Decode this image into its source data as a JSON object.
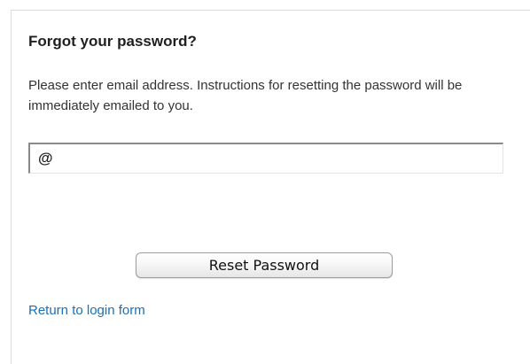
{
  "form": {
    "title": "Forgot your password?",
    "instructions": "Please enter email address. Instructions for resetting the password will be immediately emailed to you.",
    "email_placeholder": "@",
    "email_value": "",
    "reset_button_label": "Reset Password",
    "return_link_label": "Return to login form"
  },
  "colors": {
    "link": "#1b6fb5",
    "text": "#333333",
    "title": "#1f1f1f"
  }
}
